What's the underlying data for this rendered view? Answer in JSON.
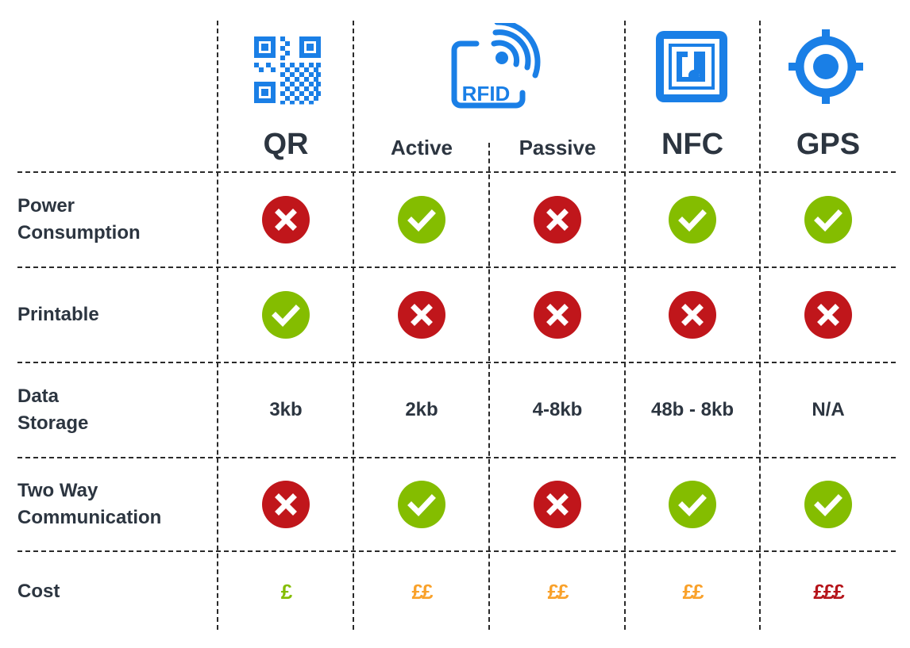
{
  "colors": {
    "icon_blue": "#1a7fe6",
    "yes_green": "#84bd00",
    "no_red": "#c0161b",
    "cost_low": "#84bd00",
    "cost_mid": "#f9a12a",
    "cost_high": "#b5141a",
    "text": "#2c3540"
  },
  "columns": [
    {
      "key": "qr",
      "label": "QR",
      "icon": "qr-code-icon"
    },
    {
      "key": "rfid_active",
      "label": "Active",
      "group": "RFID",
      "icon": "rfid-icon"
    },
    {
      "key": "rfid_passive",
      "label": "Passive",
      "group": "RFID"
    },
    {
      "key": "nfc",
      "label": "NFC",
      "icon": "nfc-icon"
    },
    {
      "key": "gps",
      "label": "GPS",
      "icon": "gps-target-icon"
    }
  ],
  "rfid_icon_text": "RFID",
  "rows": [
    {
      "label_lines": [
        "Power",
        "Consumption"
      ],
      "type": "bool",
      "values": [
        false,
        true,
        false,
        true,
        true
      ]
    },
    {
      "label_lines": [
        "Printable"
      ],
      "type": "bool",
      "values": [
        true,
        false,
        false,
        false,
        false
      ]
    },
    {
      "label_lines": [
        "Data",
        "Storage"
      ],
      "type": "text",
      "values": [
        "3kb",
        "2kb",
        "4-8kb",
        "48b - 8kb",
        "N/A"
      ]
    },
    {
      "label_lines": [
        "Two Way",
        "Communication"
      ],
      "type": "bool",
      "values": [
        false,
        true,
        false,
        true,
        true
      ]
    },
    {
      "label_lines": [
        "Cost"
      ],
      "type": "cost",
      "values": [
        "£",
        "££",
        "££",
        "££",
        "£££"
      ],
      "levels": [
        "low",
        "mid",
        "mid",
        "mid",
        "high"
      ]
    }
  ]
}
